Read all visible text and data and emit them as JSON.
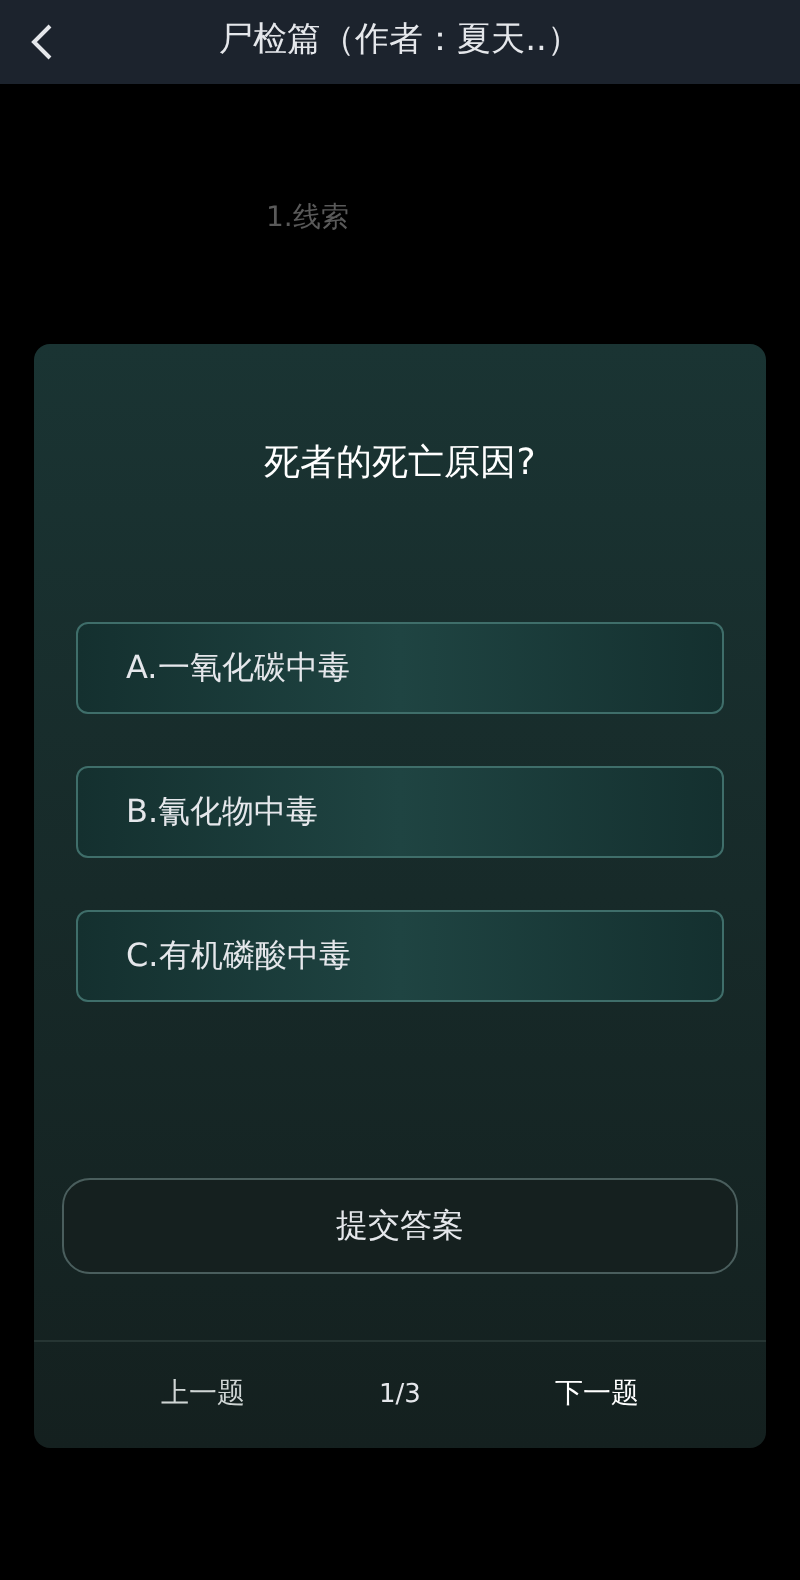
{
  "header": {
    "title": "尸检篇（作者：夏天..）"
  },
  "background": {
    "clue_title": "1.线索"
  },
  "dialog": {
    "question": "死者的死亡原因?",
    "options": [
      {
        "label": "A.一氧化碳中毒",
        "selected": false
      },
      {
        "label": "B.氰化物中毒",
        "selected": false
      },
      {
        "label": "C.有机磷酸中毒",
        "selected": false
      }
    ],
    "submit": "提交答案",
    "footer": {
      "prev": "上一题",
      "page": "1/3",
      "next": "下一题"
    }
  }
}
